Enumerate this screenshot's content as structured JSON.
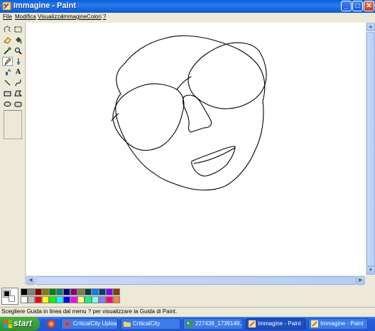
{
  "window": {
    "title": "Immagine - Paint",
    "minimize_glyph": "_",
    "maximize_glyph": "□",
    "close_glyph": "✕"
  },
  "menus": [
    "File",
    "Modifica",
    "Visualizza",
    "Immagine",
    "Colori",
    "?"
  ],
  "tools": [
    {
      "name": "free-form-select-icon"
    },
    {
      "name": "rect-select-icon"
    },
    {
      "name": "eraser-icon"
    },
    {
      "name": "fill-bucket-icon"
    },
    {
      "name": "eyedropper-icon"
    },
    {
      "name": "magnifier-icon"
    },
    {
      "name": "pencil-icon",
      "selected": true
    },
    {
      "name": "brush-icon"
    },
    {
      "name": "airbrush-icon"
    },
    {
      "name": "text-tool-icon",
      "glyph": "A"
    },
    {
      "name": "line-tool-icon"
    },
    {
      "name": "curve-tool-icon"
    },
    {
      "name": "rectangle-tool-icon"
    },
    {
      "name": "polygon-tool-icon"
    },
    {
      "name": "ellipse-tool-icon"
    },
    {
      "name": "rounded-rect-tool-icon"
    }
  ],
  "colors": {
    "foreground": "#000000",
    "background": "#ffffff",
    "palette": [
      "#000000",
      "#808080",
      "#800000",
      "#808000",
      "#008000",
      "#008080",
      "#000080",
      "#800080",
      "#808040",
      "#004040",
      "#0080ff",
      "#004080",
      "#8000ff",
      "#804000",
      "#ffffff",
      "#c0c0c0",
      "#ff0000",
      "#ffff00",
      "#00ff00",
      "#00ffff",
      "#0000ff",
      "#ff00ff",
      "#ffff80",
      "#00ff80",
      "#80ffff",
      "#8080ff",
      "#ff0080",
      "#ff8040"
    ]
  },
  "status": {
    "text": "Scegliere Guida in linea dal menu ? per visualizzare la Guida di Paint."
  },
  "taskbar": {
    "start_label": "start",
    "tasks": [
      {
        "label": "CriticalCity Upload...",
        "icon": "browser-icon",
        "active": false
      },
      {
        "label": "CriticalCity",
        "icon": "folder-icon",
        "active": false
      },
      {
        "label": "227438_1739149...",
        "icon": "image-icon",
        "active": false
      },
      {
        "label": "Immagine - Paint",
        "icon": "paint-icon",
        "active": true
      },
      {
        "label": "Immagine - Paint",
        "icon": "paint-icon",
        "active": false
      }
    ]
  }
}
